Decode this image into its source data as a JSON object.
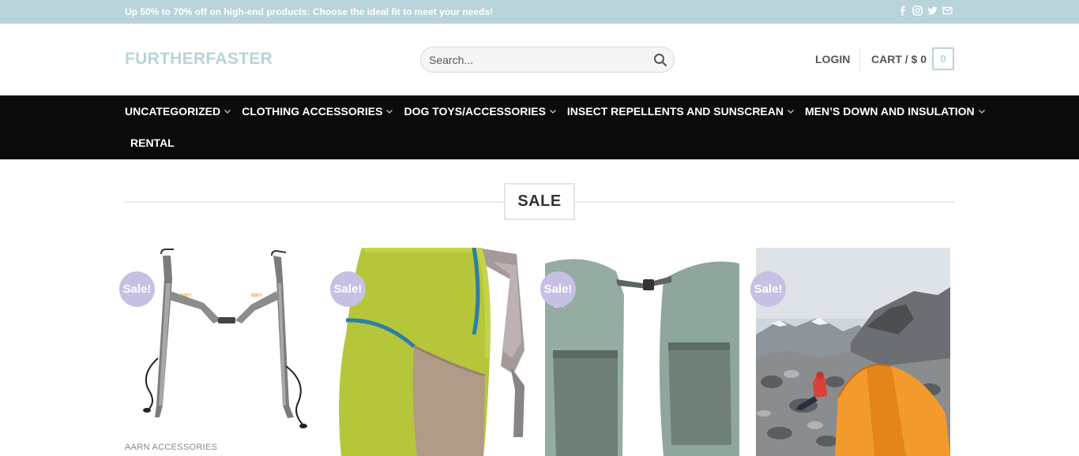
{
  "topbar": {
    "promo_text": "Up 50% to 70% off on high-end products: Choose the ideal fit to meet your needs!",
    "social_icons": [
      "facebook-icon",
      "instagram-icon",
      "twitter-icon",
      "email-icon"
    ]
  },
  "header": {
    "logo": "FURTHERFASTER",
    "search_placeholder": "Search...",
    "login_label": "LOGIN",
    "cart_label": "CART / $ 0",
    "cart_count": "0"
  },
  "nav": {
    "items": [
      {
        "label": "UNCATEGORIZED"
      },
      {
        "label": "CLOTHING ACCESSORIES"
      },
      {
        "label": "DOG TOYS/ACCESSORIES"
      },
      {
        "label": "INSECT REPELLENTS AND SUNSCREAN"
      },
      {
        "label": "MEN’S DOWN AND INSULATION"
      }
    ],
    "rental_label": "RENTAL"
  },
  "section": {
    "title": "SALE"
  },
  "products": [
    {
      "badge": "Sale!",
      "category": "AARN ACCESSORIES"
    },
    {
      "badge": "Sale!"
    },
    {
      "badge": "Sale!"
    },
    {
      "badge": "Sale!"
    }
  ],
  "colors": {
    "topbar_bg": "#b9d3da",
    "nav_bg": "#0b0b0b",
    "sale_badge": "#c6c0e3",
    "accent": "#b9d3da"
  }
}
